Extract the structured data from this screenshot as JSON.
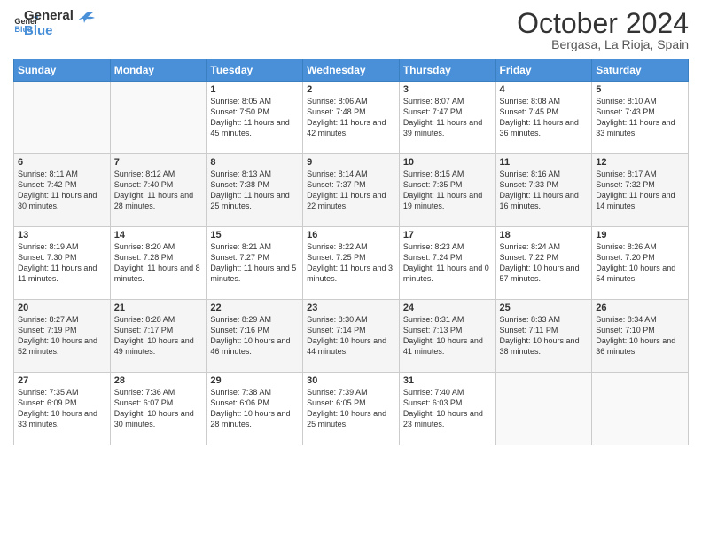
{
  "header": {
    "logo_general": "General",
    "logo_blue": "Blue",
    "month": "October 2024",
    "location": "Bergasa, La Rioja, Spain"
  },
  "weekdays": [
    "Sunday",
    "Monday",
    "Tuesday",
    "Wednesday",
    "Thursday",
    "Friday",
    "Saturday"
  ],
  "weeks": [
    [
      {
        "day": "",
        "info": ""
      },
      {
        "day": "",
        "info": ""
      },
      {
        "day": "1",
        "info": "Sunrise: 8:05 AM\nSunset: 7:50 PM\nDaylight: 11 hours and 45 minutes."
      },
      {
        "day": "2",
        "info": "Sunrise: 8:06 AM\nSunset: 7:48 PM\nDaylight: 11 hours and 42 minutes."
      },
      {
        "day": "3",
        "info": "Sunrise: 8:07 AM\nSunset: 7:47 PM\nDaylight: 11 hours and 39 minutes."
      },
      {
        "day": "4",
        "info": "Sunrise: 8:08 AM\nSunset: 7:45 PM\nDaylight: 11 hours and 36 minutes."
      },
      {
        "day": "5",
        "info": "Sunrise: 8:10 AM\nSunset: 7:43 PM\nDaylight: 11 hours and 33 minutes."
      }
    ],
    [
      {
        "day": "6",
        "info": "Sunrise: 8:11 AM\nSunset: 7:42 PM\nDaylight: 11 hours and 30 minutes."
      },
      {
        "day": "7",
        "info": "Sunrise: 8:12 AM\nSunset: 7:40 PM\nDaylight: 11 hours and 28 minutes."
      },
      {
        "day": "8",
        "info": "Sunrise: 8:13 AM\nSunset: 7:38 PM\nDaylight: 11 hours and 25 minutes."
      },
      {
        "day": "9",
        "info": "Sunrise: 8:14 AM\nSunset: 7:37 PM\nDaylight: 11 hours and 22 minutes."
      },
      {
        "day": "10",
        "info": "Sunrise: 8:15 AM\nSunset: 7:35 PM\nDaylight: 11 hours and 19 minutes."
      },
      {
        "day": "11",
        "info": "Sunrise: 8:16 AM\nSunset: 7:33 PM\nDaylight: 11 hours and 16 minutes."
      },
      {
        "day": "12",
        "info": "Sunrise: 8:17 AM\nSunset: 7:32 PM\nDaylight: 11 hours and 14 minutes."
      }
    ],
    [
      {
        "day": "13",
        "info": "Sunrise: 8:19 AM\nSunset: 7:30 PM\nDaylight: 11 hours and 11 minutes."
      },
      {
        "day": "14",
        "info": "Sunrise: 8:20 AM\nSunset: 7:28 PM\nDaylight: 11 hours and 8 minutes."
      },
      {
        "day": "15",
        "info": "Sunrise: 8:21 AM\nSunset: 7:27 PM\nDaylight: 11 hours and 5 minutes."
      },
      {
        "day": "16",
        "info": "Sunrise: 8:22 AM\nSunset: 7:25 PM\nDaylight: 11 hours and 3 minutes."
      },
      {
        "day": "17",
        "info": "Sunrise: 8:23 AM\nSunset: 7:24 PM\nDaylight: 11 hours and 0 minutes."
      },
      {
        "day": "18",
        "info": "Sunrise: 8:24 AM\nSunset: 7:22 PM\nDaylight: 10 hours and 57 minutes."
      },
      {
        "day": "19",
        "info": "Sunrise: 8:26 AM\nSunset: 7:20 PM\nDaylight: 10 hours and 54 minutes."
      }
    ],
    [
      {
        "day": "20",
        "info": "Sunrise: 8:27 AM\nSunset: 7:19 PM\nDaylight: 10 hours and 52 minutes."
      },
      {
        "day": "21",
        "info": "Sunrise: 8:28 AM\nSunset: 7:17 PM\nDaylight: 10 hours and 49 minutes."
      },
      {
        "day": "22",
        "info": "Sunrise: 8:29 AM\nSunset: 7:16 PM\nDaylight: 10 hours and 46 minutes."
      },
      {
        "day": "23",
        "info": "Sunrise: 8:30 AM\nSunset: 7:14 PM\nDaylight: 10 hours and 44 minutes."
      },
      {
        "day": "24",
        "info": "Sunrise: 8:31 AM\nSunset: 7:13 PM\nDaylight: 10 hours and 41 minutes."
      },
      {
        "day": "25",
        "info": "Sunrise: 8:33 AM\nSunset: 7:11 PM\nDaylight: 10 hours and 38 minutes."
      },
      {
        "day": "26",
        "info": "Sunrise: 8:34 AM\nSunset: 7:10 PM\nDaylight: 10 hours and 36 minutes."
      }
    ],
    [
      {
        "day": "27",
        "info": "Sunrise: 7:35 AM\nSunset: 6:09 PM\nDaylight: 10 hours and 33 minutes."
      },
      {
        "day": "28",
        "info": "Sunrise: 7:36 AM\nSunset: 6:07 PM\nDaylight: 10 hours and 30 minutes."
      },
      {
        "day": "29",
        "info": "Sunrise: 7:38 AM\nSunset: 6:06 PM\nDaylight: 10 hours and 28 minutes."
      },
      {
        "day": "30",
        "info": "Sunrise: 7:39 AM\nSunset: 6:05 PM\nDaylight: 10 hours and 25 minutes."
      },
      {
        "day": "31",
        "info": "Sunrise: 7:40 AM\nSunset: 6:03 PM\nDaylight: 10 hours and 23 minutes."
      },
      {
        "day": "",
        "info": ""
      },
      {
        "day": "",
        "info": ""
      }
    ]
  ]
}
